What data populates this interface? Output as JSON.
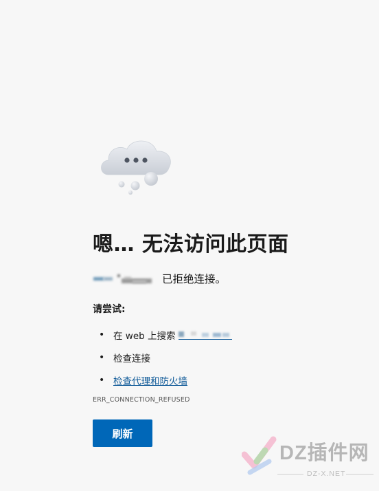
{
  "page": {
    "title": "嗯… 无法访问此页面",
    "refused_text": "已拒绝连接。",
    "try_label": "请尝试:",
    "suggestions": {
      "search_prefix": "在 web 上搜索",
      "check_connection": "检查连接",
      "check_proxy_firewall": "检查代理和防火墙"
    },
    "error_code": "ERR_CONNECTION_REFUSED",
    "refresh_label": "刷新",
    "bullet_glyph": "•"
  },
  "watermark": {
    "brand": "DZ插件网",
    "domain": "DZ-X.NET"
  },
  "colors": {
    "background": "#f7f7f7",
    "accent": "#0067b8",
    "link": "#0f5a98"
  },
  "icons": {
    "error": "cloud-with-dots-icon",
    "watermark_logo": "dz-checkmark-logo"
  }
}
